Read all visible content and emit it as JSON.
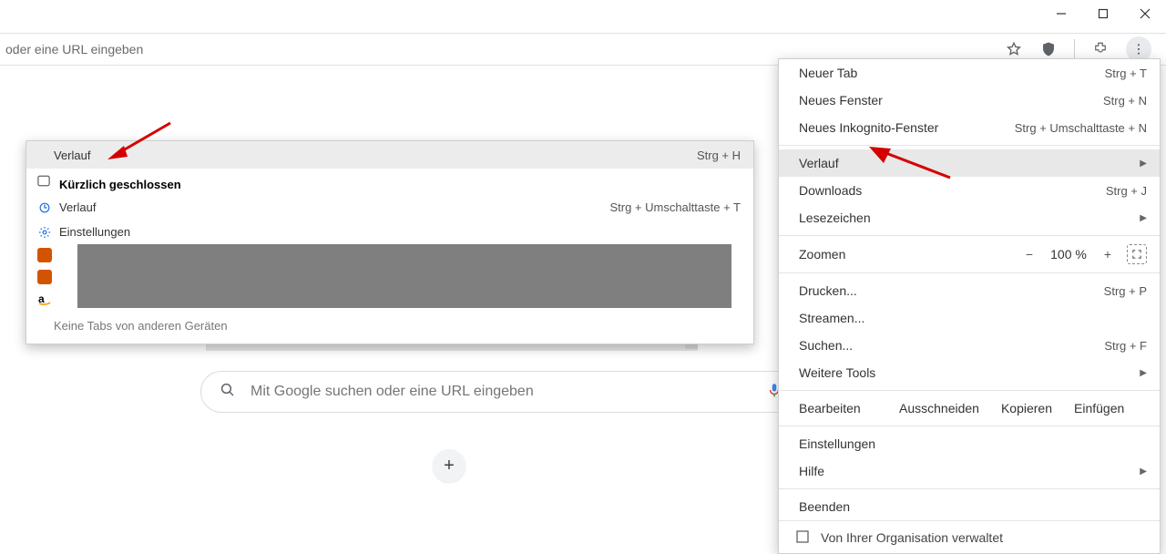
{
  "window": {
    "addressbar_placeholder": "oder eine URL eingeben"
  },
  "search": {
    "placeholder": "Mit Google suchen oder eine URL eingeben"
  },
  "submenu": {
    "title": "Verlauf",
    "shortcut": "Strg + H",
    "recently_closed": "Kürzlich geschlossen",
    "items": [
      {
        "label": "Verlauf",
        "shortcut": "Strg + Umschalttaste + T",
        "icon": "reopen"
      },
      {
        "label": "Einstellungen",
        "shortcut": "",
        "icon": "gear"
      }
    ],
    "footer": "Keine Tabs von anderen Geräten"
  },
  "menu": {
    "new_tab": {
      "label": "Neuer Tab",
      "shortcut": "Strg + T"
    },
    "new_window": {
      "label": "Neues Fenster",
      "shortcut": "Strg + N"
    },
    "incognito": {
      "label": "Neues Inkognito-Fenster",
      "shortcut": "Strg + Umschalttaste + N"
    },
    "history": {
      "label": "Verlauf"
    },
    "downloads": {
      "label": "Downloads",
      "shortcut": "Strg + J"
    },
    "bookmarks": {
      "label": "Lesezeichen"
    },
    "zoom_label": "Zoomen",
    "zoom_value": "100 %",
    "print": {
      "label": "Drucken...",
      "shortcut": "Strg + P"
    },
    "cast": {
      "label": "Streamen..."
    },
    "find": {
      "label": "Suchen...",
      "shortcut": "Strg + F"
    },
    "more_tools": {
      "label": "Weitere Tools"
    },
    "edit": {
      "label": "Bearbeiten",
      "cut": "Ausschneiden",
      "copy": "Kopieren",
      "paste": "Einfügen"
    },
    "settings": {
      "label": "Einstellungen"
    },
    "help": {
      "label": "Hilfe"
    },
    "exit": {
      "label": "Beenden"
    },
    "managed": "Von Ihrer Organisation verwaltet"
  }
}
